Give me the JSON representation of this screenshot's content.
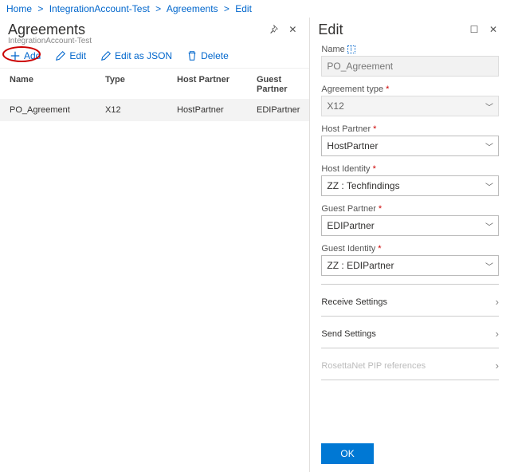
{
  "breadcrumbs": {
    "home": "Home",
    "account": "IntegrationAccount-Test",
    "agreements": "Agreements",
    "edit": "Edit"
  },
  "listBlade": {
    "title": "Agreements",
    "subtitle": "IntegrationAccount-Test",
    "toolbar": {
      "add": "Add",
      "edit": "Edit",
      "editJson": "Edit as JSON",
      "delete": "Delete"
    },
    "columns": {
      "name": "Name",
      "type": "Type",
      "host": "Host Partner",
      "guest": "Guest Partner"
    },
    "rows": [
      {
        "name": "PO_Agreement",
        "type": "X12",
        "host": "HostPartner",
        "guest": "EDIPartner"
      }
    ]
  },
  "editBlade": {
    "title": "Edit",
    "labels": {
      "name": "Name",
      "agreementType": "Agreement type",
      "hostPartner": "Host Partner",
      "hostIdentity": "Host Identity",
      "guestPartner": "Guest Partner",
      "guestIdentity": "Guest Identity",
      "receiveSettings": "Receive Settings",
      "sendSettings": "Send Settings",
      "rosetta": "RosettaNet PIP references",
      "ok": "OK"
    },
    "values": {
      "name": "PO_Agreement",
      "agreementType": "X12",
      "hostPartner": "HostPartner",
      "hostIdentity": "ZZ : Techfindings",
      "guestPartner": "EDIPartner",
      "guestIdentity": "ZZ : EDIPartner"
    }
  }
}
